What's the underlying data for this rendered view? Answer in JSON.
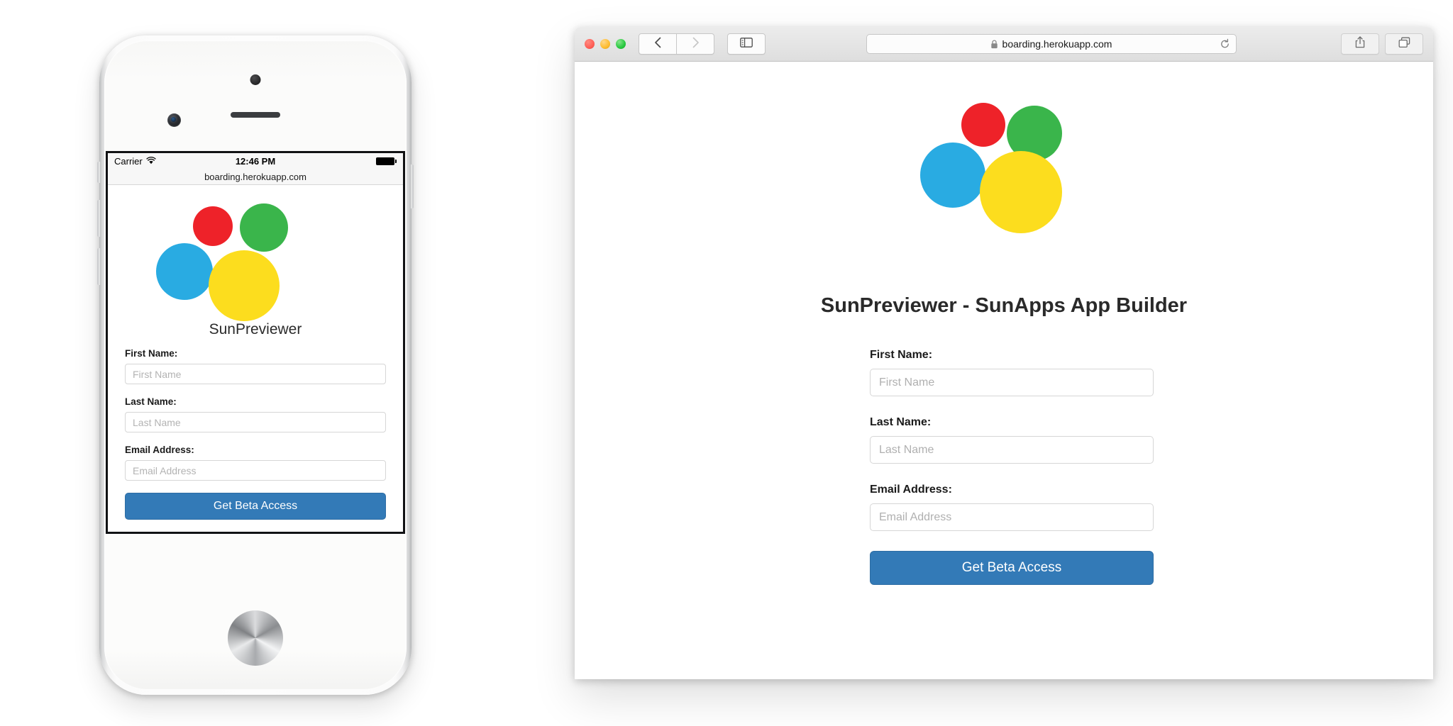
{
  "colors": {
    "logo_red": "#ee2229",
    "logo_green": "#3ab54b",
    "logo_blue": "#29abe2",
    "logo_yellow": "#fcdd1e",
    "button_blue": "#337ab7",
    "button_border": "#2e6da4"
  },
  "phone": {
    "status_bar": {
      "carrier": "Carrier",
      "wifi_icon": "wifi-icon",
      "time": "12:46 PM",
      "battery_icon": "battery-full-icon"
    },
    "url_bar": {
      "url": "boarding.herokuapp.com"
    },
    "page": {
      "logo_alt": "sunapps-logo",
      "title": "SunPreviewer",
      "fields": [
        {
          "label": "First Name:",
          "placeholder": "First Name",
          "value": "",
          "name": "first-name"
        },
        {
          "label": "Last Name:",
          "placeholder": "Last Name",
          "value": "",
          "name": "last-name"
        },
        {
          "label": "Email Address:",
          "placeholder": "Email Address",
          "value": "",
          "name": "email-address"
        }
      ],
      "submit_label": "Get Beta Access"
    }
  },
  "browser": {
    "window_controls": {
      "close": "close-window-button",
      "minimize": "minimize-window-button",
      "zoom": "zoom-window-button"
    },
    "toolbar": {
      "back_icon": "chevron-left-icon",
      "forward_icon": "chevron-right-icon",
      "sidebar_icon": "sidebar-icon",
      "share_icon": "share-icon",
      "tabs_icon": "show-all-tabs-icon",
      "new_tab_label": "+"
    },
    "address_bar": {
      "lock_icon": "lock-icon",
      "url": "boarding.herokuapp.com",
      "reload_icon": "reload-icon"
    },
    "page": {
      "logo_alt": "sunapps-logo",
      "title": "SunPreviewer - SunApps App Builder",
      "fields": [
        {
          "label": "First Name:",
          "placeholder": "First Name",
          "value": "",
          "name": "first-name"
        },
        {
          "label": "Last Name:",
          "placeholder": "Last Name",
          "value": "",
          "name": "last-name"
        },
        {
          "label": "Email Address:",
          "placeholder": "Email Address",
          "value": "",
          "name": "email-address"
        }
      ],
      "submit_label": "Get Beta Access"
    }
  }
}
